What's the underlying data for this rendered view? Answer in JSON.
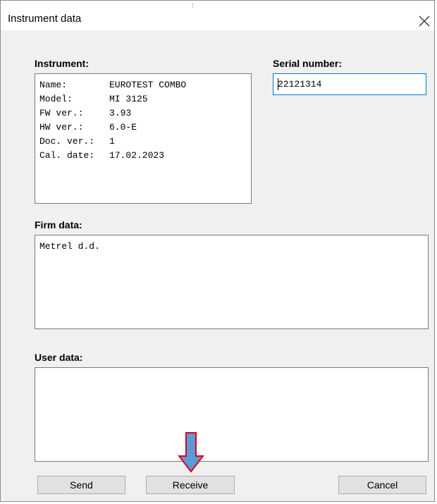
{
  "window": {
    "title": "Instrument data"
  },
  "instrument": {
    "label": "Instrument:",
    "rows": [
      {
        "key": "Name:",
        "value": "EUROTEST COMBO"
      },
      {
        "key": "Model:",
        "value": "MI 3125"
      },
      {
        "key": "FW ver.:",
        "value": "3.93"
      },
      {
        "key": "HW ver.:",
        "value": "6.0-E"
      },
      {
        "key": "Doc. ver.:",
        "value": "1"
      },
      {
        "key": "Cal. date:",
        "value": "17.02.2023"
      }
    ]
  },
  "serial": {
    "label": "Serial number:",
    "value": "22121314"
  },
  "firm": {
    "label": "Firm data:",
    "value": "Metrel d.d."
  },
  "user": {
    "label": "User data:",
    "value": ""
  },
  "buttons": {
    "send": "Send",
    "receive": "Receive",
    "cancel": "Cancel"
  },
  "colors": {
    "arrow_fill": "#5b9bd5",
    "arrow_outline": "#e0001a",
    "focus_border": "#0078d7"
  },
  "icons": {
    "close": "close-icon",
    "pointer": "down-arrow-icon"
  }
}
